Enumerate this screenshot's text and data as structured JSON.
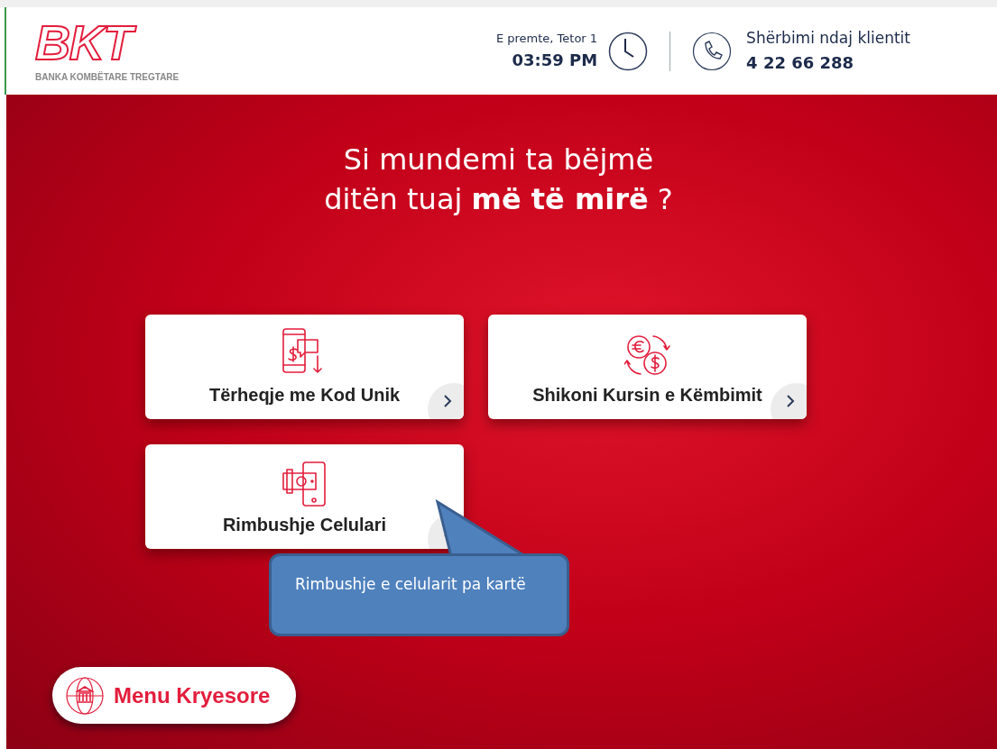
{
  "logo": {
    "mark": "BKT",
    "name": "BANKA KOMBËTARE TREGTARE"
  },
  "header": {
    "date": "E premte, Tetor 1",
    "time": "03:59 PM",
    "service_label": "Shërbimi ndaj klientit",
    "service_phone": "4 22 66 288"
  },
  "heading": [
    "Si mundemi ta bëjmë",
    "ditën tuaj **më të mirë** ?"
  ],
  "services": [
    {
      "label": "Tërheqje me Kod Unik",
      "kind": "sms"
    },
    {
      "label": "Shikoni Kursin e Këmbimit",
      "kind": "exchange"
    },
    {
      "label": "Rimbushje Celulari",
      "kind": "topup"
    }
  ],
  "callout": {
    "text": "Rimbushje e celularit pa kartë"
  },
  "menu_button": {
    "label": "Menu Kryesore"
  }
}
